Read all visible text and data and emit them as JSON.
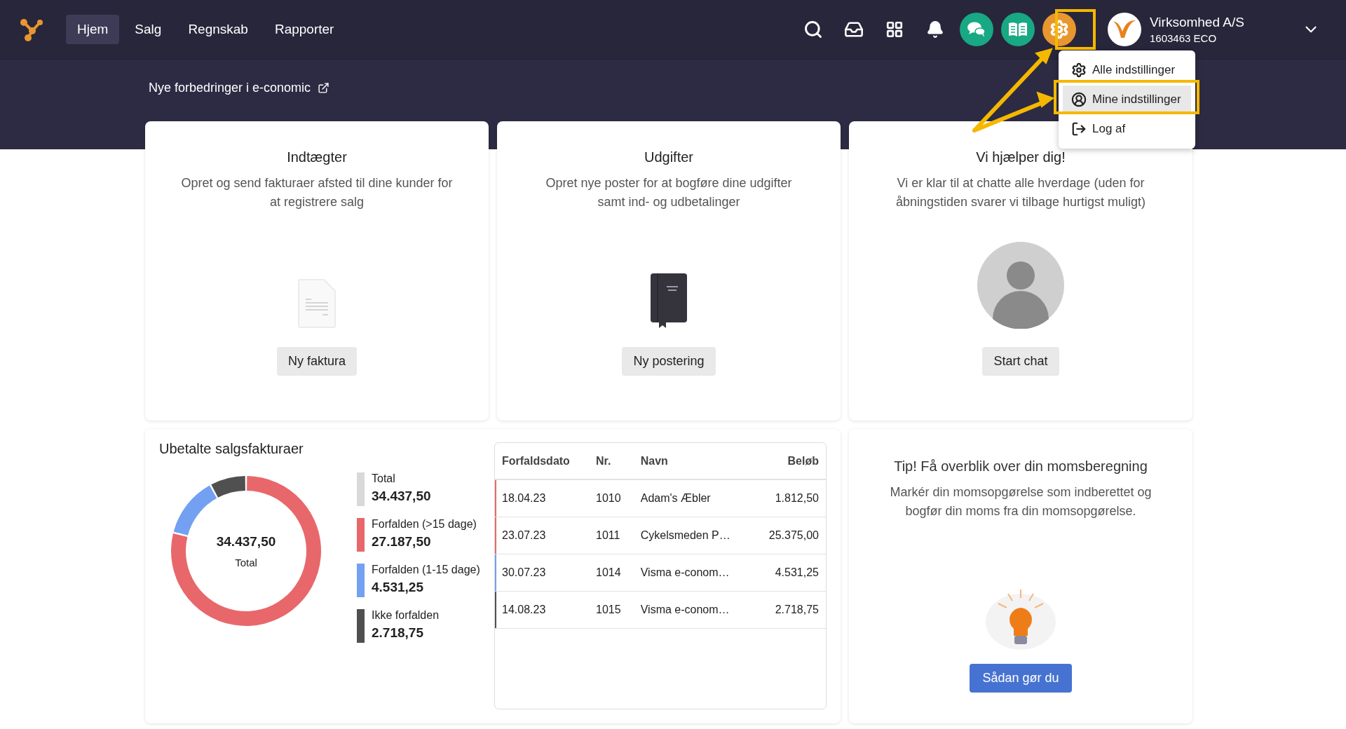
{
  "topbar": {
    "nav": [
      {
        "label": "Hjem",
        "selected": true
      },
      {
        "label": "Salg",
        "selected": false
      },
      {
        "label": "Regnskab",
        "selected": false
      },
      {
        "label": "Rapporter",
        "selected": false
      }
    ],
    "company": {
      "name": "Virksomhed A/S",
      "id": "1603463 ECO"
    },
    "settings_menu": [
      {
        "label": "Alle indstillinger",
        "selected": false
      },
      {
        "label": "Mine indstillinger",
        "selected": true
      },
      {
        "label": "Log af",
        "selected": false
      }
    ]
  },
  "announcement": "Nye forbedringer i e-conomic",
  "action_cards": [
    {
      "kind": "invoice",
      "title": "Indtægter",
      "text": "Opret og send fakturaer afsted til dine kunder for at registrere salg",
      "button": "Ny faktura"
    },
    {
      "kind": "book",
      "title": "Udgifter",
      "text": "Opret nye poster for at bogføre dine udgifter samt ind- og udbetalinger",
      "button": "Ny postering"
    },
    {
      "kind": "person",
      "title": "Vi hjælper dig!",
      "text": "Vi er klar til at chatte alle hverdage (uden for åbningstiden svarer vi tilbage hurtigst muligt)",
      "button": "Start chat"
    }
  ],
  "unpaid": {
    "title": "Ubetalte salgsfakturaer",
    "center_value": "34.437,50",
    "center_label": "Total",
    "chart_data": {
      "type": "donut",
      "categories": [
        "Forfalden (>15 dage)",
        "Forfalden (1-15 dage)",
        "Ikke forfalden"
      ],
      "values": [
        78.95,
        13.16,
        7.89
      ]
    },
    "legend_total": {
      "label": "Total",
      "value": "34.437,50",
      "color": "#d9d9d9"
    },
    "legend": [
      {
        "color": "#e8676b",
        "value": "27.187,50"
      },
      {
        "color": "#73a0f0",
        "value": "4.531,25"
      },
      {
        "color": "#505050",
        "value": "2.718,75"
      }
    ],
    "table": {
      "columns": [
        "Forfaldsdato",
        "Nr.",
        "Navn",
        "Beløb"
      ],
      "rows": [
        {
          "color": "#e8676b",
          "cells": [
            "18.04.23",
            "1010",
            "Adam's Æbler",
            "1.812,50"
          ]
        },
        {
          "color": "#e8676b",
          "cells": [
            "23.07.23",
            "1011",
            "Cykelsmeden P…",
            "25.375,00"
          ]
        },
        {
          "color": "#73a0f0",
          "cells": [
            "30.07.23",
            "1014",
            "Visma e-conom…",
            "4.531,25"
          ]
        },
        {
          "color": "#505050",
          "cells": [
            "14.08.23",
            "1015",
            "Visma e-conom…",
            "2.718,75"
          ]
        }
      ]
    }
  },
  "tip": {
    "title": "Tip! Få overblik over din momsberegning",
    "text": "Markér din momsopgørelse som indberettet og bogfør din moms fra din momsopgørelse.",
    "button": "Sådan gør du"
  }
}
